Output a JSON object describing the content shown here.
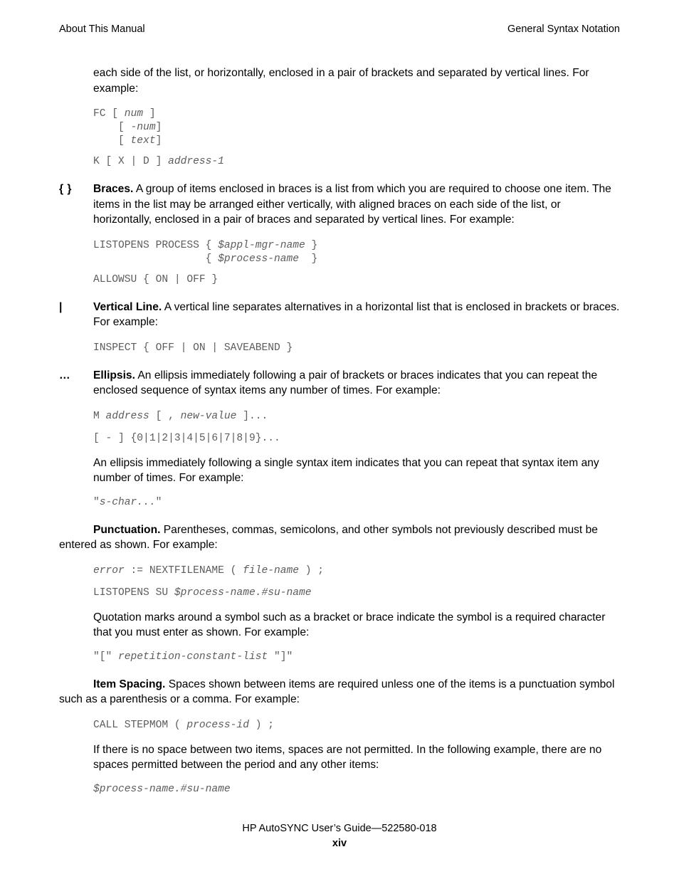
{
  "header": {
    "left": "About This Manual",
    "right": "General Syntax Notation"
  },
  "body": {
    "intro_paragraph": "each side of the list, or horizontally, enclosed in a pair of brackets and separated by vertical lines. For example:",
    "code_brackets": {
      "line1_pre": "FC [ ",
      "line1_var": "num",
      "line1_post": " ]",
      "line2_pre": "    [ ",
      "line2_var": "-num",
      "line2_post": "]",
      "line3_pre": "    [ ",
      "line3_var": "text",
      "line3_post": "]",
      "line4_pre": "K [ X | D ] ",
      "line4_var": "address-1",
      "line4_post": ""
    },
    "braces": {
      "marker": "{ }",
      "term": "Braces.",
      "text": " A group of items enclosed in braces is a list from which you are required to choose one item.  The items in the list may be arranged either vertically, with aligned braces on each side of the list, or horizontally, enclosed in a pair of braces and separated by vertical lines.  For example:",
      "code_line1_pre": "LISTOPENS PROCESS { ",
      "code_line1_var": "$appl-mgr-name",
      "code_line1_post": " }",
      "code_line2_pre": "                  { ",
      "code_line2_var": "$process-name",
      "code_line2_post": "  }",
      "code_line3": "ALLOWSU { ON | OFF }"
    },
    "vertical_line": {
      "marker": "|",
      "term": "Vertical Line.",
      "text": " A vertical line separates alternatives in a horizontal list that is enclosed in brackets or braces.  For example:",
      "code_line1": "INSPECT { OFF | ON | SAVEABEND }"
    },
    "ellipsis": {
      "marker": "…",
      "term": "Ellipsis.",
      "text": " An ellipsis immediately following a pair of brackets or braces indicates that you can repeat the enclosed sequence of syntax items any number of times.  For example:",
      "code_line1_pre": "M ",
      "code_line1_var1": "address",
      "code_line1_mid": " [ , ",
      "code_line1_var2": "new-value",
      "code_line1_post": " ]...",
      "code_line2": "[ - ] {0|1|2|3|4|5|6|7|8|9}...",
      "paragraph2": "An ellipsis immediately following a single syntax item indicates that you can repeat that syntax item any number of times.  For example:",
      "code_line3_pre": "\"",
      "code_line3_var": "s-char...",
      "code_line3_post": "\""
    },
    "punctuation": {
      "term": "Punctuation.",
      "text": " Parentheses, commas, semicolons, and other symbols not previously described must be entered as shown.  For example:",
      "code_line1_var1": "error",
      "code_line1_mid": " := NEXTFILENAME ( ",
      "code_line1_var2": "file-name",
      "code_line1_post": " ) ;",
      "code_line2_pre": "LISTOPENS SU ",
      "code_line2_var": "$process-name.#su-name",
      "paragraph2": "Quotation marks around a symbol such as a bracket or brace indicate the symbol is a required character that you must enter as shown.  For example:",
      "code_line3_pre": "\"[\" ",
      "code_line3_var": "repetition-constant-list",
      "code_line3_post": " \"]\""
    },
    "item_spacing": {
      "term": "Item Spacing.",
      "text": " Spaces shown between items are required unless one of the items is a punctuation symbol such as a parenthesis or a comma.  For example:",
      "code_line1_pre": "CALL STEPMOM ( ",
      "code_line1_var": "process-id",
      "code_line1_post": " ) ;",
      "paragraph2": "If there is no space between two items, spaces are not permitted.  In the following example, there are no spaces permitted between the period and any other items:",
      "code_line2_var": "$process-name.#su-name"
    }
  },
  "footer": {
    "doc_line": "HP AutoSYNC User’s Guide—522580-018",
    "page_number": "xiv"
  }
}
